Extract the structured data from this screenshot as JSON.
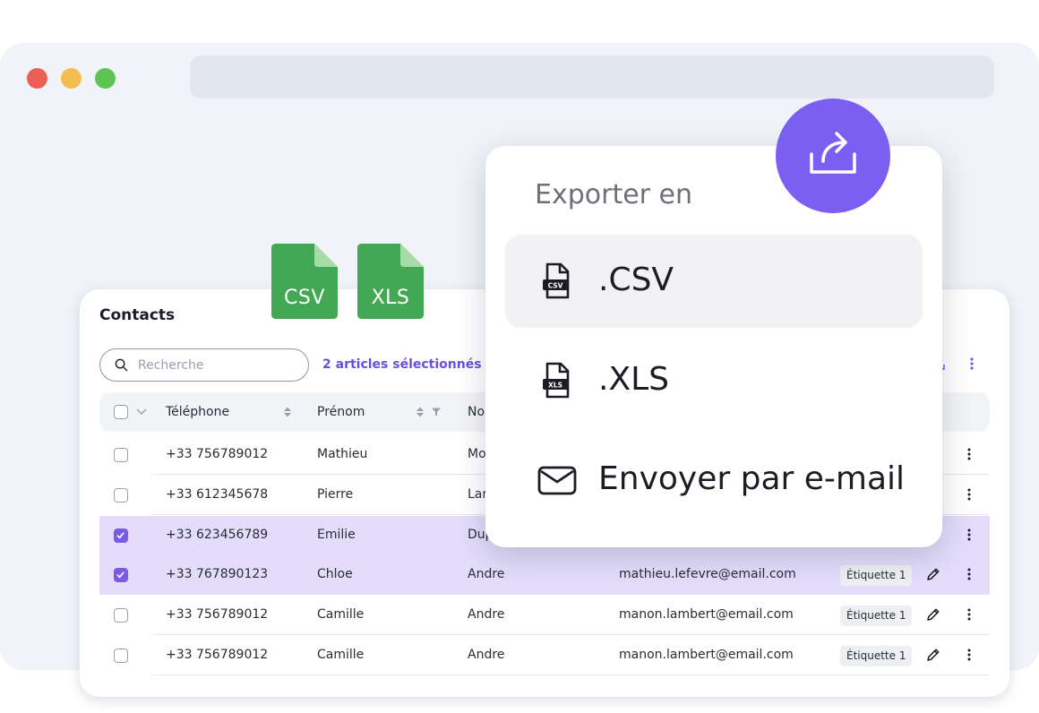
{
  "browser": {
    "dots": [
      "close-dot",
      "minimize-dot",
      "maximize-dot"
    ]
  },
  "file_badges": {
    "csv": "CSV",
    "xls": "XLS"
  },
  "contacts": {
    "title": "Contacts",
    "search_placeholder": "Recherche",
    "selected_text": "2 articles sélectionnés",
    "columns": {
      "phone": "Téléphone",
      "firstname": "Prénom",
      "lastname": "No"
    },
    "rows": [
      {
        "phone": "+33 756789012",
        "firstname": "Mathieu",
        "lastname": "Mo",
        "email": "",
        "tag": "",
        "selected": false
      },
      {
        "phone": "+33 612345678",
        "firstname": "Pierre",
        "lastname": "Lar",
        "email": "",
        "tag": "",
        "selected": false
      },
      {
        "phone": "+33 623456789",
        "firstname": "Emilie",
        "lastname": "Dup",
        "email": "",
        "tag": "",
        "selected": true
      },
      {
        "phone": "+33 767890123",
        "firstname": "Chloe",
        "lastname": "Andre",
        "email": "mathieu.lefevre@email.com",
        "tag": "Étiquette 1",
        "selected": true
      },
      {
        "phone": "+33 756789012",
        "firstname": "Camille",
        "lastname": "Andre",
        "email": "manon.lambert@email.com",
        "tag": "Étiquette 1",
        "selected": false
      },
      {
        "phone": "+33 756789012",
        "firstname": "Camille",
        "lastname": "Andre",
        "email": "manon.lambert@email.com",
        "tag": "Étiquette 1",
        "selected": false
      }
    ]
  },
  "export_menu": {
    "title": "Exporter en",
    "options": [
      {
        "label": ".CSV",
        "icon": "csv-file-icon",
        "badge": "CSV",
        "active": true
      },
      {
        "label": ".XLS",
        "icon": "xls-file-icon",
        "badge": "XLS",
        "active": false
      },
      {
        "label": "Envoyer par e-mail",
        "icon": "mail-icon",
        "active": false
      }
    ]
  },
  "colors": {
    "accent": "#7b5ef2",
    "selected_row": "#e3dcfb",
    "file_green": "#43a853",
    "file_fold": "#a7dca9"
  }
}
